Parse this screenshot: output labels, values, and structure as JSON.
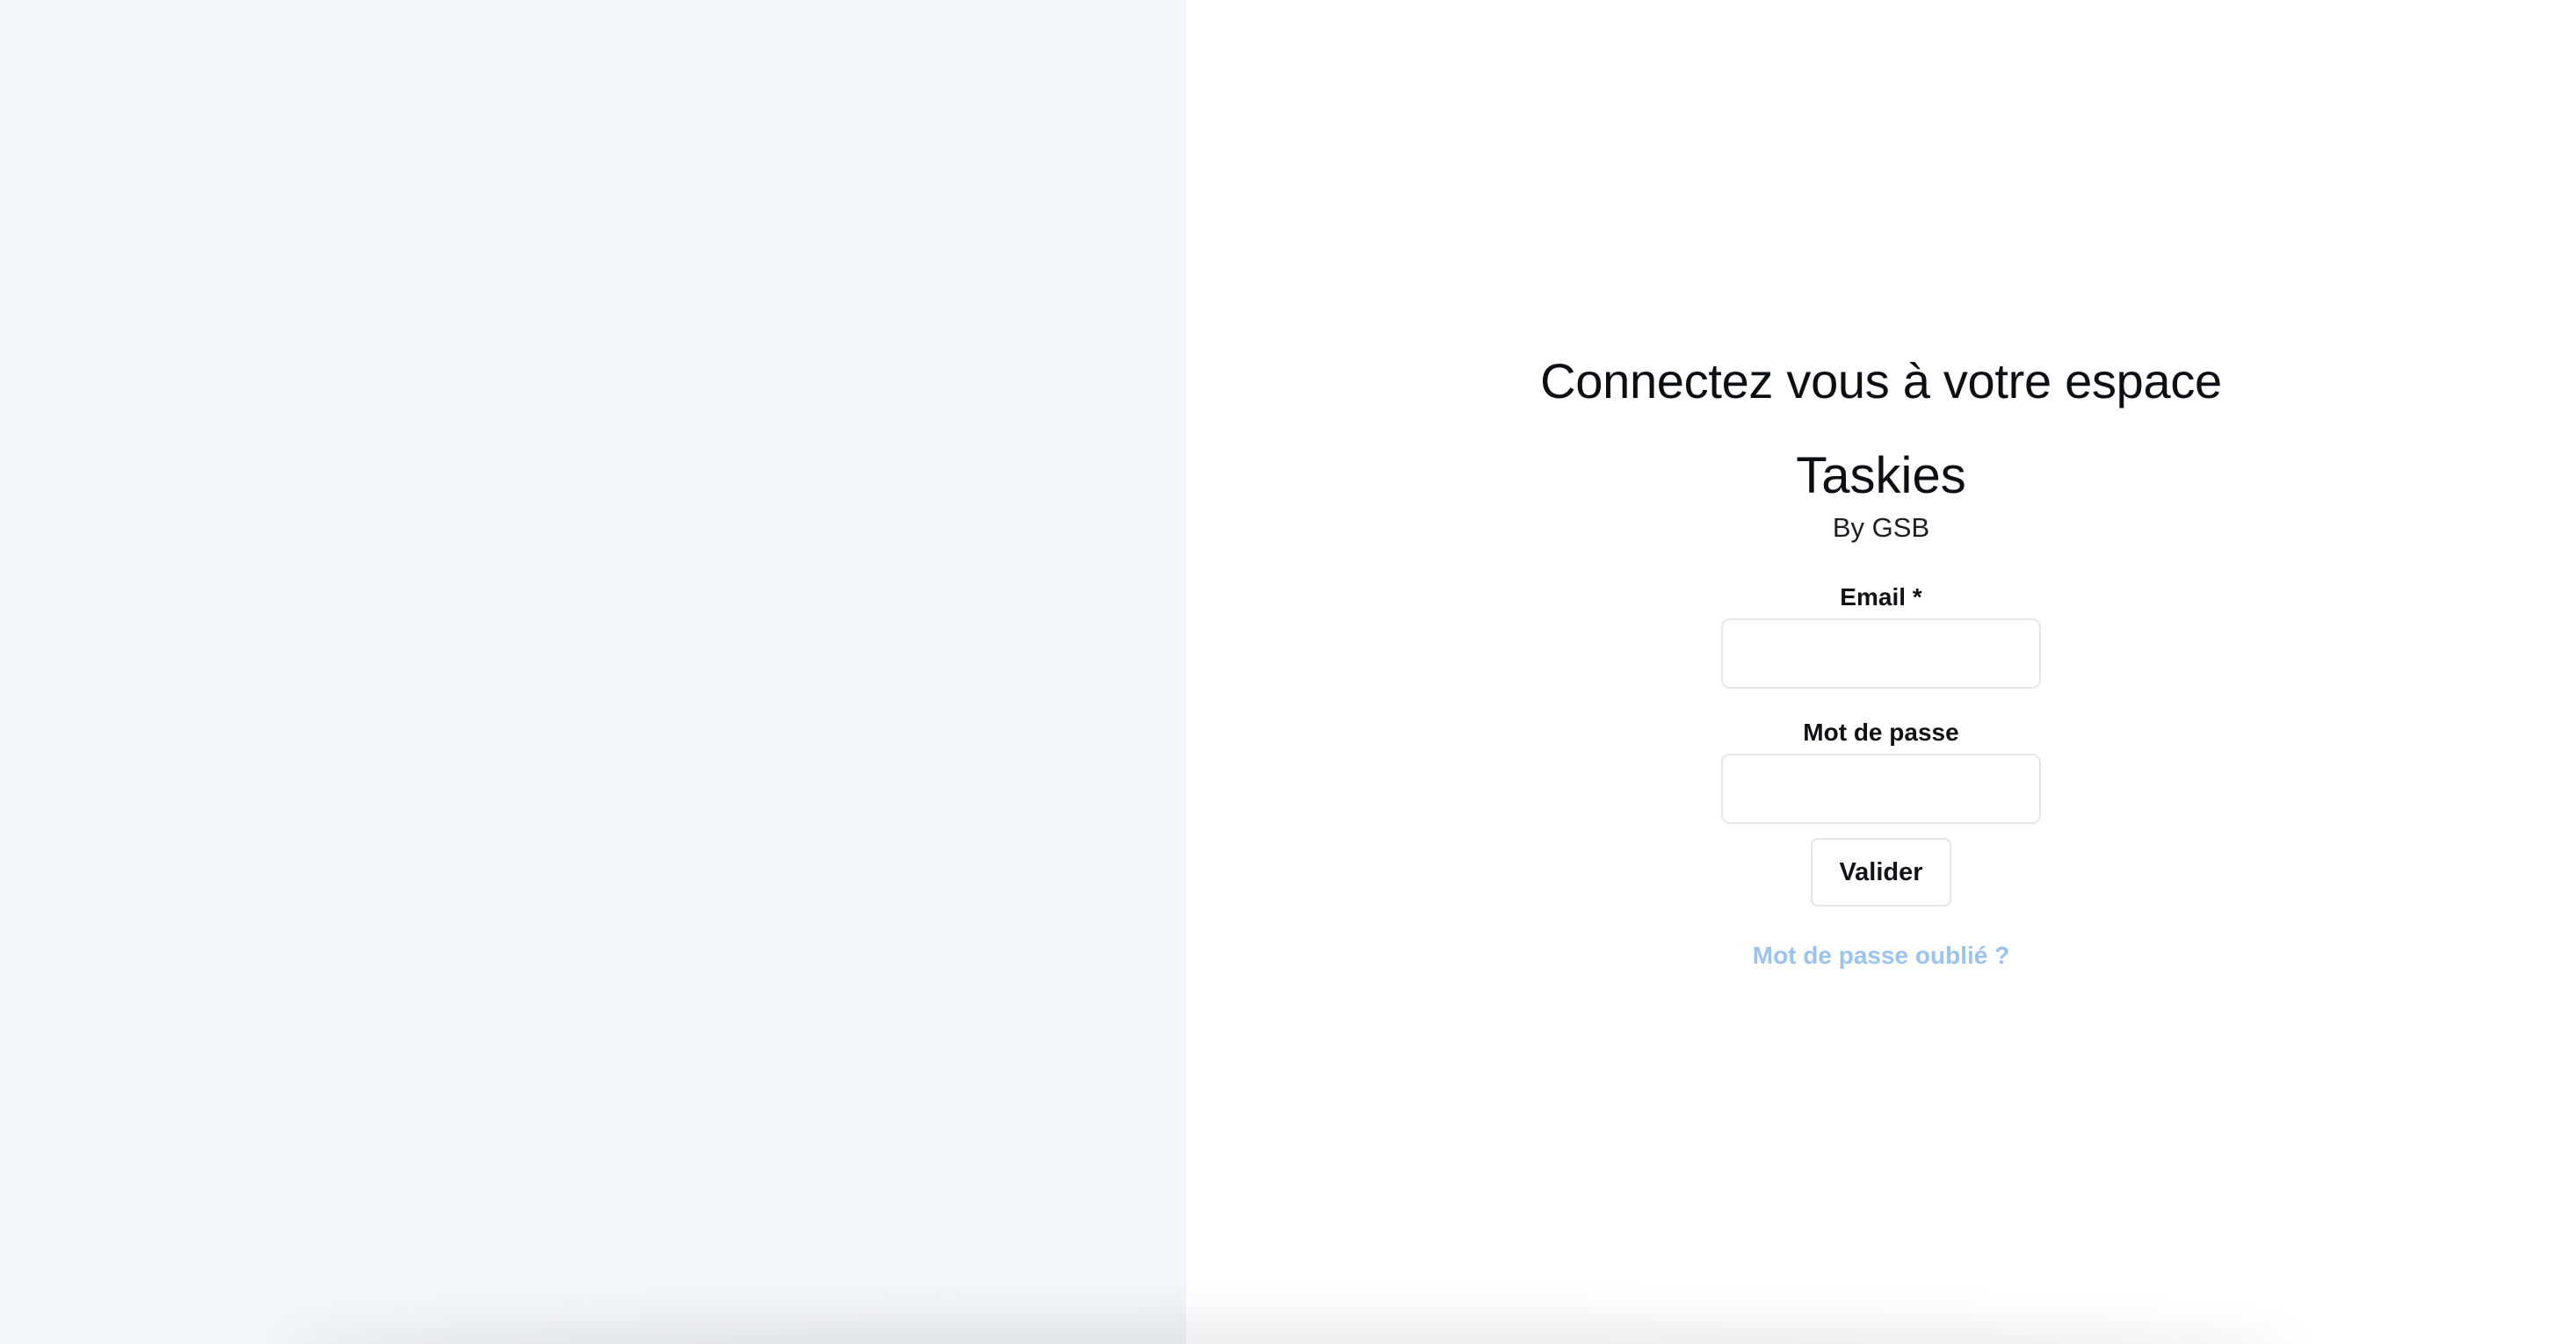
{
  "colors": {
    "left_panel_background": "#f2f5fa",
    "right_panel_background": "#ffffff",
    "link": "#9ac3ef",
    "input_border": "#e3e6eb"
  },
  "login": {
    "heading": "Connectez vous à votre espace",
    "brand": "Taskies",
    "tagline": "By GSB",
    "email_label": "Email *",
    "email_value": "",
    "password_label": "Mot de passe",
    "password_value": "",
    "submit_label": "Valider",
    "forgot_password_label": "Mot de passe oublié ?"
  }
}
